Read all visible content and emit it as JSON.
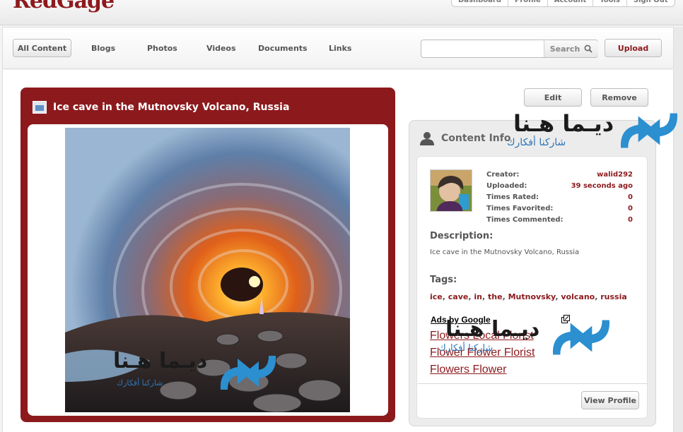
{
  "brand": {
    "logo_text": "RedGage"
  },
  "topnav": {
    "items": [
      "Dashboard",
      "Profile",
      "Account",
      "Tools",
      "Sign Out"
    ]
  },
  "nav": {
    "all_content": "All Content",
    "links": [
      "Blogs",
      "Photos",
      "Videos",
      "Documents",
      "Links"
    ],
    "search_placeholder": "",
    "search_label": "Search",
    "upload_label": "Upload"
  },
  "content": {
    "title": "Ice cave in the Mutnovsky Volcano, Russia",
    "edit_label": "Edit",
    "remove_label": "Remove"
  },
  "info": {
    "heading": "Content Info",
    "stats": [
      {
        "label": "Creator:",
        "value": "walid292"
      },
      {
        "label": "Uploaded:",
        "value": "39 seconds ago"
      },
      {
        "label": "Times Rated:",
        "value": "0"
      },
      {
        "label": "Times Favorited:",
        "value": "0"
      },
      {
        "label": "Times Commented:",
        "value": "0"
      }
    ],
    "description_title": "Description:",
    "description": "Ice cave in the Mutnovsky Volcano, Russia",
    "tags_title": "Tags:",
    "tags": [
      "ice",
      "cave",
      "in",
      "the",
      "Mutnovsky",
      "volcano",
      "russia"
    ],
    "ads_by": "Ads by Google",
    "ads": [
      "Flowers Local Florist",
      "Flower Flower Florist",
      "Flowers Flower"
    ],
    "view_profile_label": "View Profile"
  },
  "watermark": {
    "main": "ديـما هـنا",
    "sub": "شاركنا أفكارك"
  },
  "colors": {
    "brand": "#8c1a1d",
    "arrow": "#2b8fd0"
  }
}
